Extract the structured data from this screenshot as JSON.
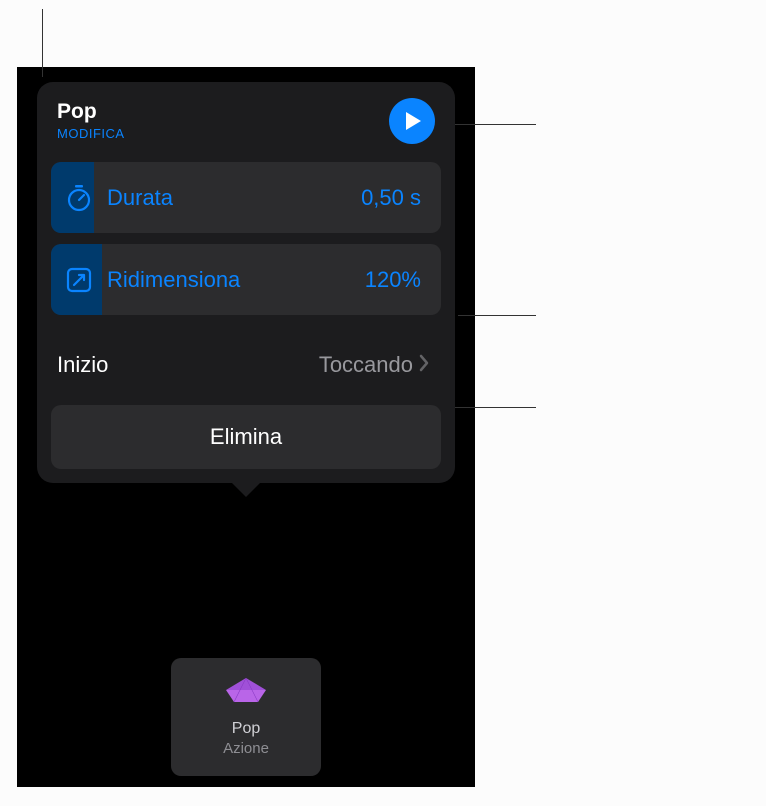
{
  "popover": {
    "title": "Pop",
    "edit_label": "MODIFICA",
    "duration": {
      "label": "Durata",
      "value": "0,50 s",
      "fill_percent": 11
    },
    "resize": {
      "label": "Ridimensiona",
      "value": "120%",
      "fill_percent": 13
    },
    "start": {
      "label": "Inizio",
      "value": "Toccando"
    },
    "delete_label": "Elimina"
  },
  "tile": {
    "name": "Pop",
    "subtitle": "Azione"
  }
}
